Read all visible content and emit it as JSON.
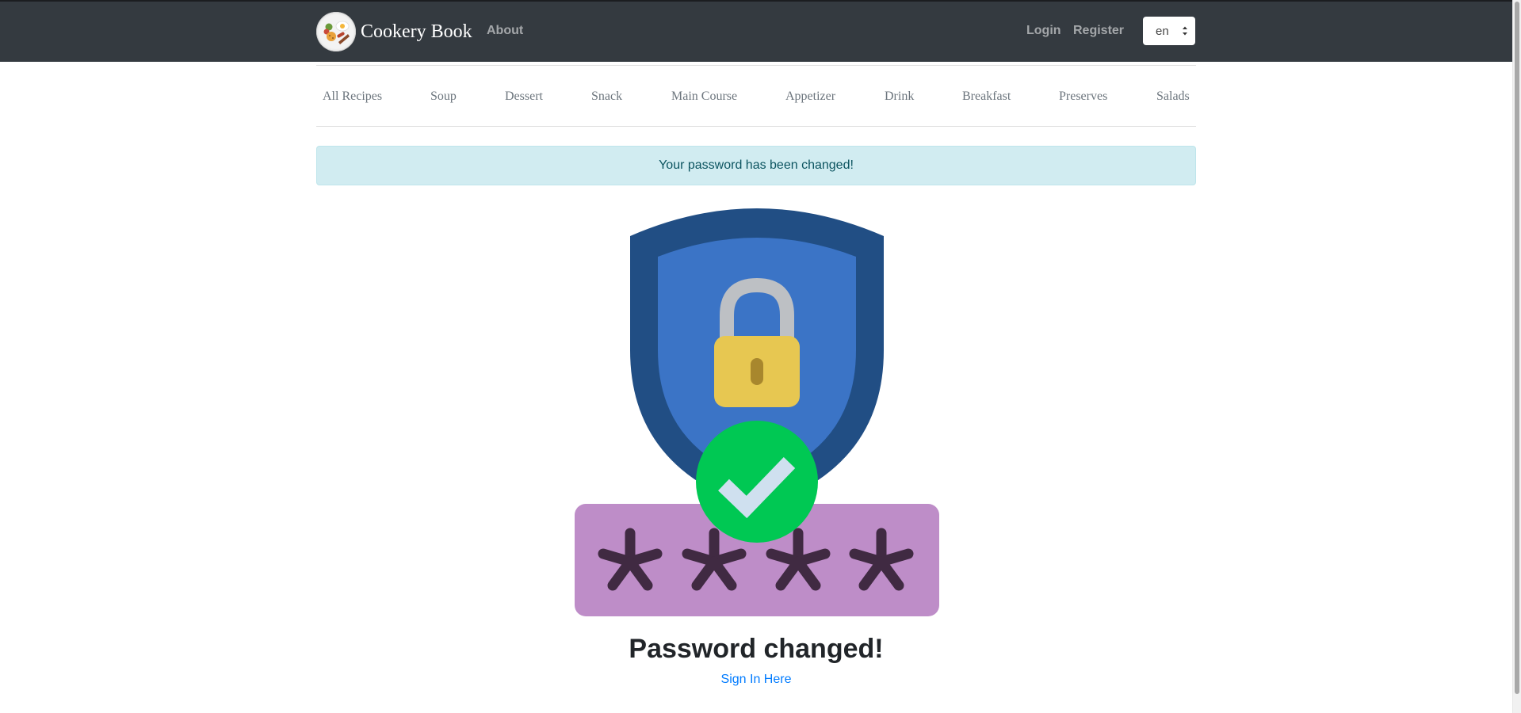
{
  "app": {
    "brand_name": "Cookery Book"
  },
  "navbar": {
    "about_label": "About",
    "login_label": "Login",
    "register_label": "Register",
    "language": {
      "selected": "en"
    }
  },
  "categories": [
    {
      "label": "All Recipes"
    },
    {
      "label": "Soup"
    },
    {
      "label": "Dessert"
    },
    {
      "label": "Snack"
    },
    {
      "label": "Main Course"
    },
    {
      "label": "Appetizer"
    },
    {
      "label": "Drink"
    },
    {
      "label": "Breakfast"
    },
    {
      "label": "Preserves"
    },
    {
      "label": "Salads"
    }
  ],
  "alert": {
    "message": "Your password has been changed!"
  },
  "main": {
    "title": "Password changed!",
    "sign_in_link": "Sign In Here",
    "illustration_icons": [
      "shield-icon",
      "lock-icon",
      "check-circle-icon",
      "asterisk-icon"
    ]
  },
  "colors": {
    "navbar_bg": "#343a40",
    "alert_bg": "#d1ecf1",
    "alert_text": "#0c5460",
    "link": "#007bff",
    "shield_outer": "#214e84",
    "shield_inner": "#3b74c6",
    "lock_body": "#e7c751",
    "lock_shackle": "#bdc0c4",
    "check_circle": "#00c853",
    "password_box": "#be8dc8",
    "asterisk": "#402a42"
  }
}
